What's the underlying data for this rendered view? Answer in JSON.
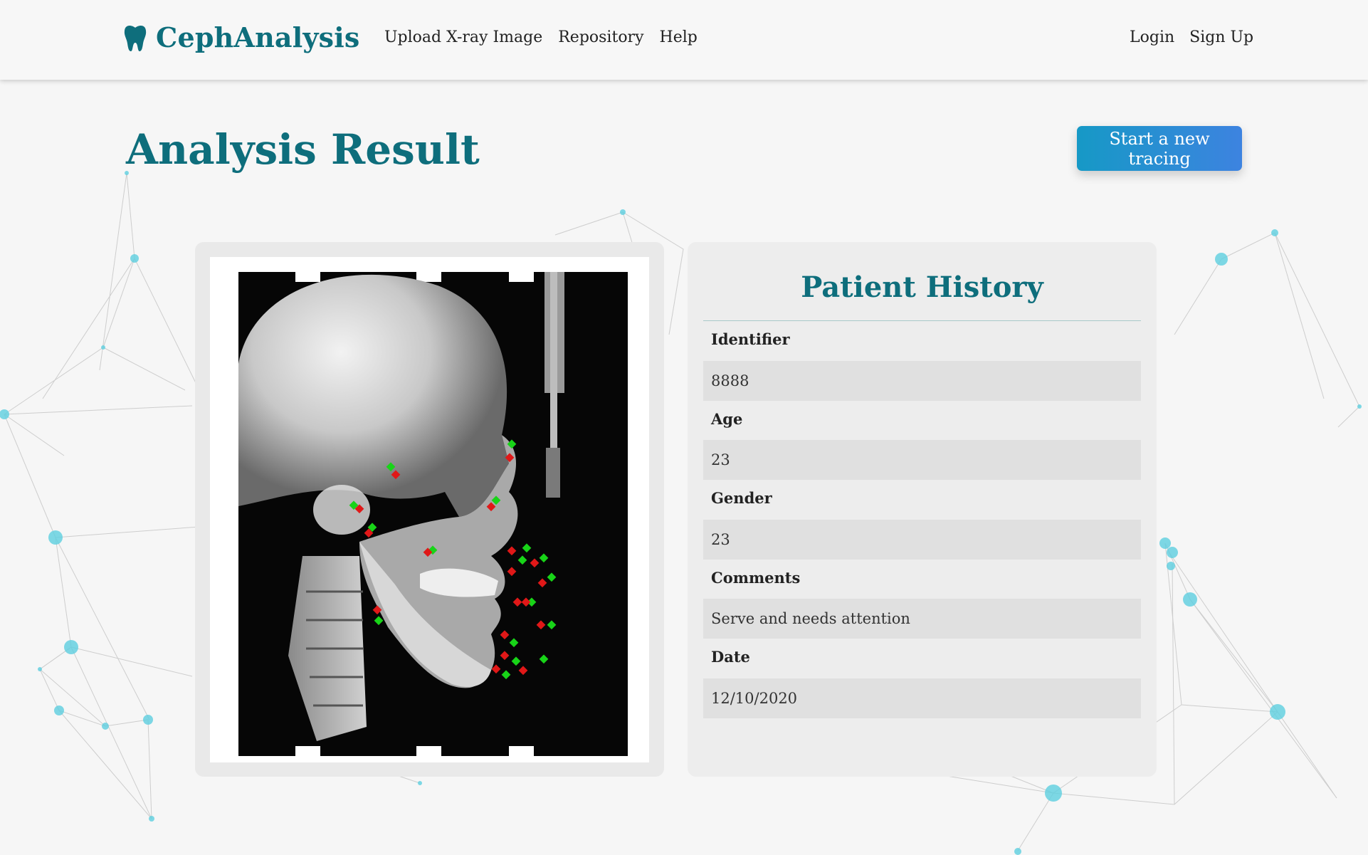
{
  "brand": {
    "name": "CephAnalysis",
    "icon": "tooth-icon"
  },
  "nav": {
    "links": [
      "Upload X-ray Image",
      "Repository",
      "Help"
    ],
    "auth": [
      "Login",
      "Sign Up"
    ]
  },
  "page": {
    "title": "Analysis Result",
    "new_tracing_button": "Start a new tracing"
  },
  "xray": {
    "image": "lateral cephalometric x-ray",
    "marker_colors": {
      "predicted": "#e01818",
      "reference": "#18d418"
    }
  },
  "history": {
    "title": "Patient History",
    "fields": [
      {
        "label": "Identifier",
        "value": "8888"
      },
      {
        "label": "Age",
        "value": "23"
      },
      {
        "label": "Gender",
        "value": "23"
      },
      {
        "label": "Comments",
        "value": "Serve and needs attention"
      },
      {
        "label": "Date",
        "value": "12/10/2020"
      }
    ]
  },
  "colors": {
    "brand": "#0e6e7c",
    "button_gradient_start": "#1699c6",
    "button_gradient_end": "#3d83e0",
    "background": "#f6f6f6",
    "network_nodes": "#5ecfe0"
  }
}
